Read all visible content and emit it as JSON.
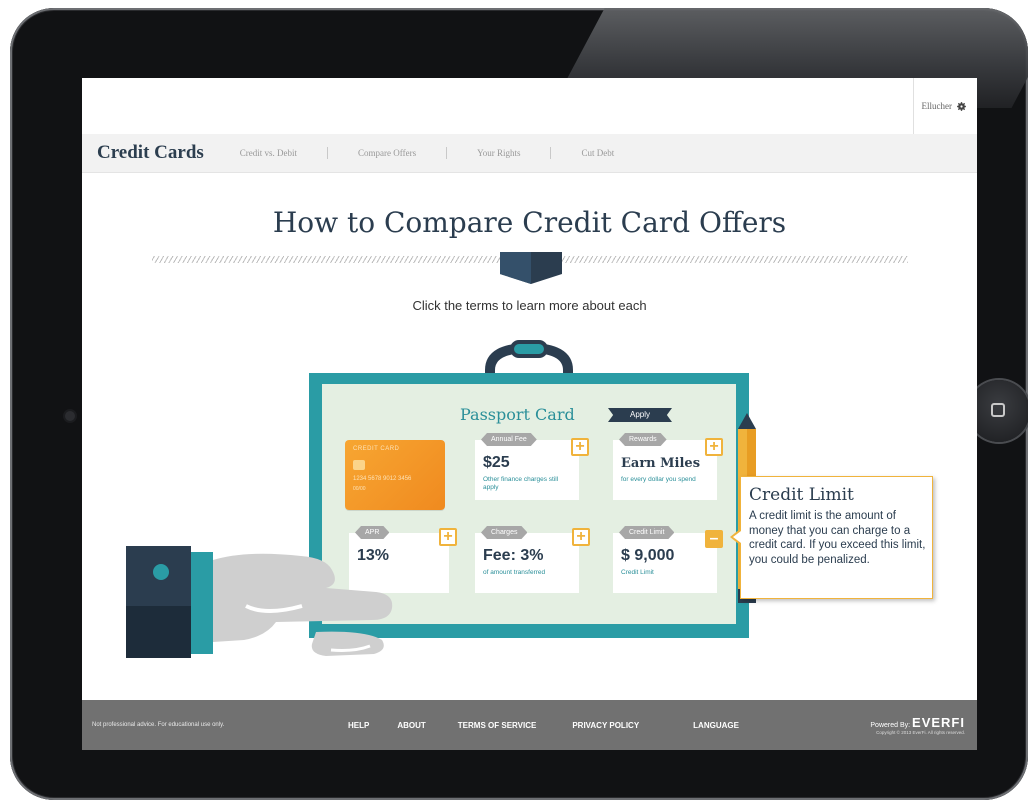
{
  "header": {
    "user_name": "Ellucher",
    "section_title": "Credit Cards",
    "nav": [
      {
        "label": "Credit vs. Debit"
      },
      {
        "label": "Compare Offers"
      },
      {
        "label": "Your Rights"
      },
      {
        "label": "Cut Debt"
      }
    ]
  },
  "main": {
    "title": "How to Compare Credit Card Offers",
    "subtitle": "Click the terms to learn more about each",
    "card_name": "Passport Card",
    "apply_label": "Apply",
    "credit_card": {
      "label": "CREDIT CARD",
      "number": "1234 5678 9012 3456",
      "expiry": "00/00"
    },
    "terms": [
      {
        "tag": "Annual Fee",
        "value": "$25",
        "note": "Other finance charges still apply"
      },
      {
        "tag": "Rewards",
        "value": "Earn Miles",
        "note": "for every dollar you spend"
      },
      {
        "tag": "APR",
        "value": "13%",
        "note": ""
      },
      {
        "tag": "Charges",
        "value": "Fee: 3%",
        "note": "of amount transferred"
      },
      {
        "tag": "Credit Limit",
        "value": "$ 9,000",
        "note": "Credit Limit"
      }
    ],
    "tooltip": {
      "title": "Credit Limit",
      "body": "A credit limit is the amount of money that you can charge to a credit card. If you exceed this limit, you could be penalized."
    }
  },
  "footer": {
    "disclaimer": "Not professional advice. For educational use only.",
    "links": [
      {
        "label": "HELP"
      },
      {
        "label": "ABOUT"
      },
      {
        "label": "TERMS OF SERVICE"
      },
      {
        "label": "PRIVACY POLICY"
      },
      {
        "label": "LANGUAGE"
      }
    ],
    "powered_by": "Powered By:",
    "brand": "EVERFI",
    "copyright": "Copyright © 2013 EverFi. All rights reserved."
  },
  "colors": {
    "teal": "#2a9ca5",
    "navy": "#2b3d4f",
    "accent_orange": "#f0b33c",
    "card_orange": "#f7a632",
    "footer_gray": "#717171"
  },
  "icons": [
    "gear-icon",
    "plus-icon",
    "minus-icon",
    "chevron-banner-icon",
    "clipboard-handle-icon",
    "pencil-icon",
    "hand-illustration"
  ]
}
